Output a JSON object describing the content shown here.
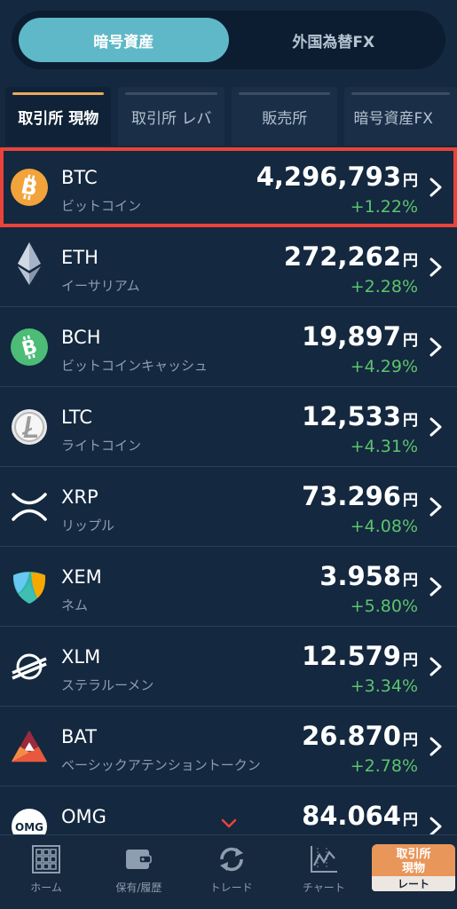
{
  "segment": {
    "options": [
      "暗号資産",
      "外国為替FX"
    ],
    "selected": "暗号資産"
  },
  "tabs": [
    "取引所 現物",
    "取引所 レバ",
    "販売所",
    "暗号資産FX"
  ],
  "coins": [
    {
      "symbol": "BTC",
      "name": "ビットコイン",
      "price": "4,296,793",
      "change": "+1.22%",
      "icon": "bitcoin-icon",
      "color": "#f2a33a"
    },
    {
      "symbol": "ETH",
      "name": "イーサリアム",
      "price": "272,262",
      "change": "+2.28%",
      "icon": "ethereum-icon",
      "color": "#8d9bb4"
    },
    {
      "symbol": "BCH",
      "name": "ビットコインキャッシュ",
      "price": "19,897",
      "change": "+4.29%",
      "icon": "bitcoin-cash-icon",
      "color": "#4cbc77"
    },
    {
      "symbol": "LTC",
      "name": "ライトコイン",
      "price": "12,533",
      "change": "+4.31%",
      "icon": "litecoin-icon",
      "color": "#e6e6e6"
    },
    {
      "symbol": "XRP",
      "name": "リップル",
      "price": "73.296",
      "change": "+4.08%",
      "icon": "ripple-icon",
      "color": "#ffffff"
    },
    {
      "symbol": "XEM",
      "name": "ネム",
      "price": "3.958",
      "change": "+5.80%",
      "icon": "nem-icon",
      "color": "#3fbfb0"
    },
    {
      "symbol": "XLM",
      "name": "ステラルーメン",
      "price": "12.579",
      "change": "+3.34%",
      "icon": "stellar-icon",
      "color": "#ffffff"
    },
    {
      "symbol": "BAT",
      "name": "ベーシックアテンショントークン",
      "price": "26.870",
      "change": "+2.78%",
      "icon": "bat-icon",
      "color": "#e8583d"
    },
    {
      "symbol": "OMG",
      "name": "",
      "price": "84.064",
      "change": "",
      "icon": "omg-icon",
      "color": "#ffffff"
    }
  ],
  "currency_unit": "円",
  "bottom_nav": {
    "items": [
      "ホーム",
      "保有/履歴",
      "トレード",
      "チャート"
    ],
    "active_top": "取引所\n現物",
    "active_bottom": "レート"
  },
  "colors": {
    "background": "#14283f",
    "accent": "#5fb8c7",
    "tab_active_bar": "#e9a85d",
    "positive": "#5cc46e",
    "highlight": "#e8443a",
    "nav_active": "#e8965a"
  }
}
